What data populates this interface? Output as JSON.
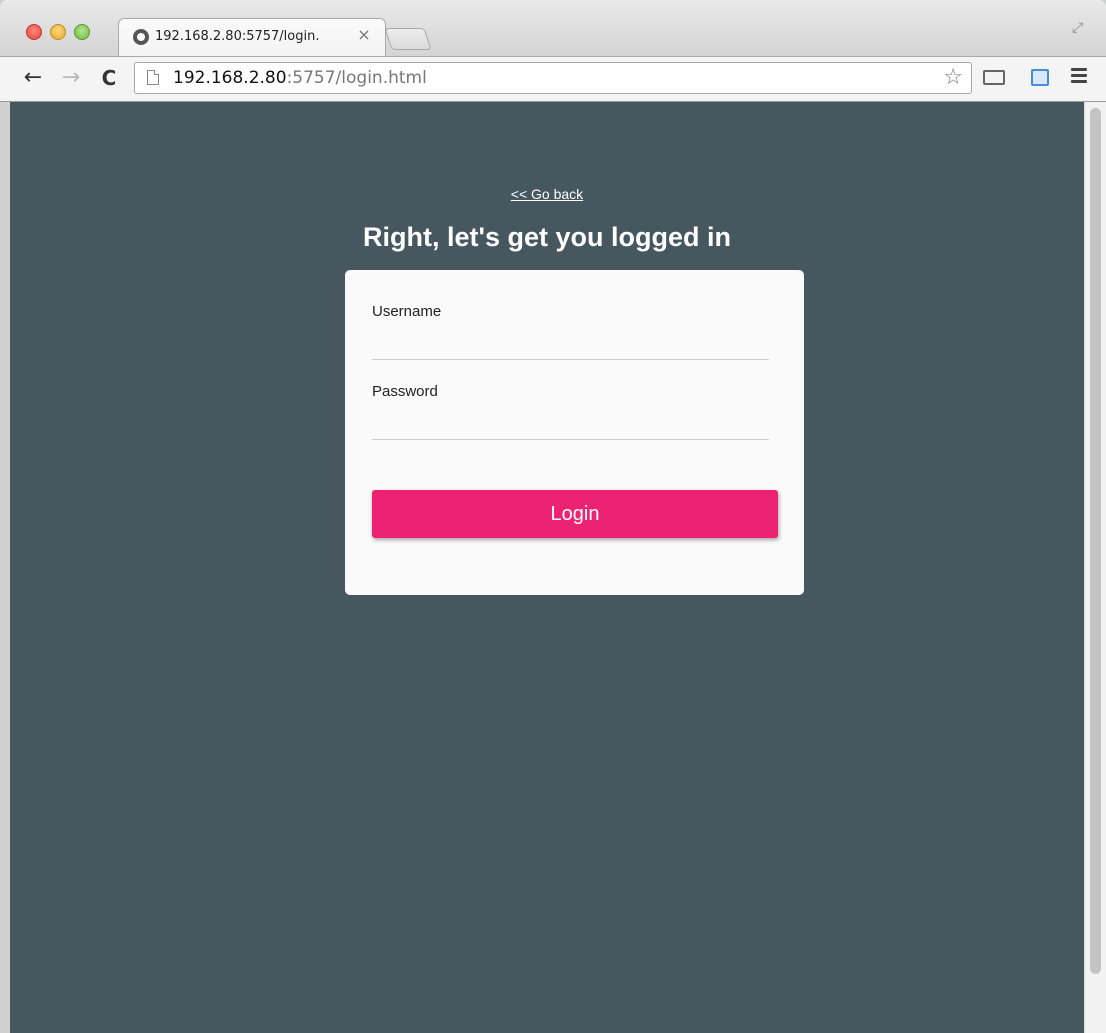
{
  "browser": {
    "tab_title": "192.168.2.80:5757/login.",
    "tab_close": "×",
    "url_host": "192.168.2.80",
    "url_rest": ":5757/login.html",
    "back_glyph": "←",
    "forward_glyph": "→",
    "reload_glyph": "C",
    "star_glyph": "☆",
    "fullscreen_glyph": "⤢"
  },
  "page": {
    "back_link": "<< Go back",
    "heading": "Right, let's get you logged in",
    "username_label": "Username",
    "username_value": "",
    "password_label": "Password",
    "password_value": "",
    "login_button": "Login"
  },
  "colors": {
    "page_background": "#465760",
    "card_background": "#fafafa",
    "login_button": "#ec2373"
  }
}
